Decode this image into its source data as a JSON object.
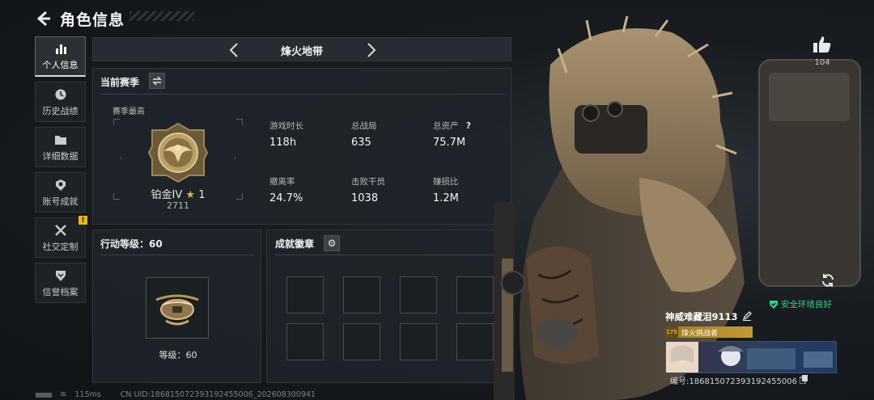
{
  "header": {
    "title": "角色信息"
  },
  "sidebar": {
    "items": [
      {
        "label": "个人信息",
        "icon": "bar-chart-icon",
        "active": true
      },
      {
        "label": "历史战绩",
        "icon": "clock-icon"
      },
      {
        "label": "详细数据",
        "icon": "folder-icon"
      },
      {
        "label": "账号成就",
        "icon": "medal-icon"
      },
      {
        "label": "社交定制",
        "icon": "tools-icon",
        "badge": "!"
      },
      {
        "label": "信誉档案",
        "icon": "shield-icon"
      }
    ]
  },
  "season_selector": {
    "title": "烽火地带"
  },
  "current_season": {
    "heading": "当前赛季",
    "season_best_label": "赛季最高",
    "rank_name": "铂金IV",
    "rank_stars": "1",
    "rank_score": "2711",
    "stats": [
      {
        "label": "游戏时长",
        "value": "118h"
      },
      {
        "label": "总战局",
        "value": "635"
      },
      {
        "label": "总资产",
        "value": "75.7M",
        "help": "?"
      },
      {
        "label": "撤离率",
        "value": "24.7%"
      },
      {
        "label": "击败干员",
        "value": "1038"
      },
      {
        "label": "赚损比",
        "value": "1.2M"
      }
    ]
  },
  "action_level": {
    "heading": "行动等级：60",
    "level_text": "等级：60"
  },
  "achievements": {
    "heading": "成就徽章"
  },
  "like": {
    "count": "104"
  },
  "environment": {
    "text": "安全环境良好",
    "color": "#33d38a"
  },
  "player": {
    "name": "神威难藏泪9113",
    "level_badge": "175",
    "title": "烽火挑战者",
    "id_text": "编号:18681507239319245500​6"
  },
  "status_bar": {
    "ping": "115ms",
    "uid_text": "CN UID:18681507239319245500​6_202608300941"
  },
  "colors": {
    "accent_gold": "#c39a32",
    "safe_green": "#33d38a"
  }
}
